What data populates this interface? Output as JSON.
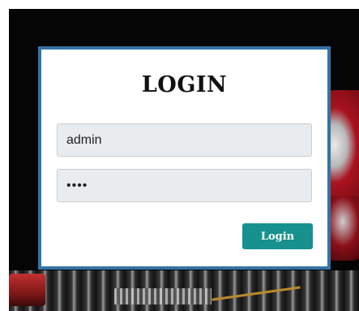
{
  "login": {
    "title": "LOGIN",
    "username_value": "admin",
    "password_value": "1234",
    "button_label": "Login"
  },
  "colors": {
    "card_border": "#3373a7",
    "button_bg": "#17918d",
    "field_bg": "#e9ecef",
    "backdrop": "#050505"
  },
  "background": {
    "icon": "engine-photo"
  }
}
